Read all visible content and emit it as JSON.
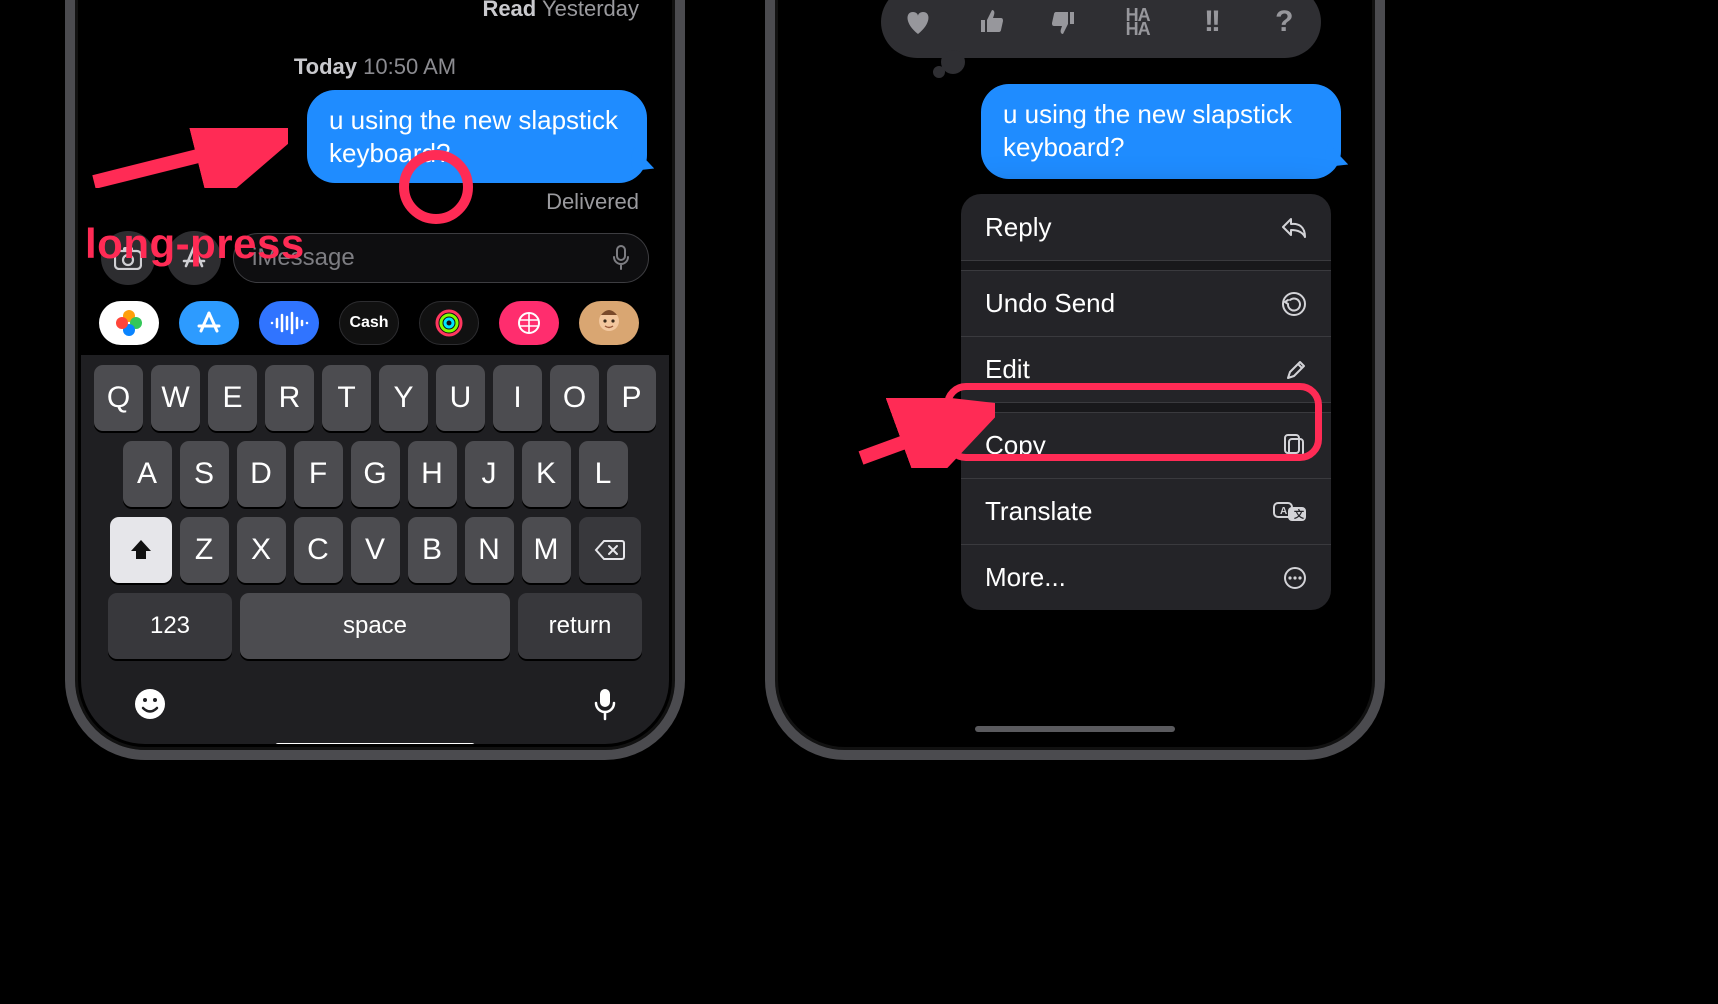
{
  "left": {
    "read_status_prefix": "Read",
    "read_status_time": "Yesterday",
    "timestamp_day": "Today",
    "timestamp_time": "10:50 AM",
    "message": "u using the new slapstick keyboard?",
    "delivered": "Delivered",
    "compose_placeholder": "iMessage",
    "app_cash_label": "Cash",
    "annotation_text": "long-press",
    "keyboard": {
      "row1": [
        "Q",
        "W",
        "E",
        "R",
        "T",
        "Y",
        "U",
        "I",
        "O",
        "P"
      ],
      "row2": [
        "A",
        "S",
        "D",
        "F",
        "G",
        "H",
        "J",
        "K",
        "L"
      ],
      "row3": [
        "Z",
        "X",
        "C",
        "V",
        "B",
        "N",
        "M"
      ],
      "numbers_label": "123",
      "space_label": "space",
      "return_label": "return"
    }
  },
  "right": {
    "message": "u using the new slapstick keyboard?",
    "tapbacks": [
      "heart",
      "thumbs-up",
      "thumbs-down",
      "haha",
      "exclaim",
      "question"
    ],
    "menu": {
      "reply": "Reply",
      "undo": "Undo Send",
      "edit": "Edit",
      "copy": "Copy",
      "translate": "Translate",
      "more": "More..."
    }
  }
}
